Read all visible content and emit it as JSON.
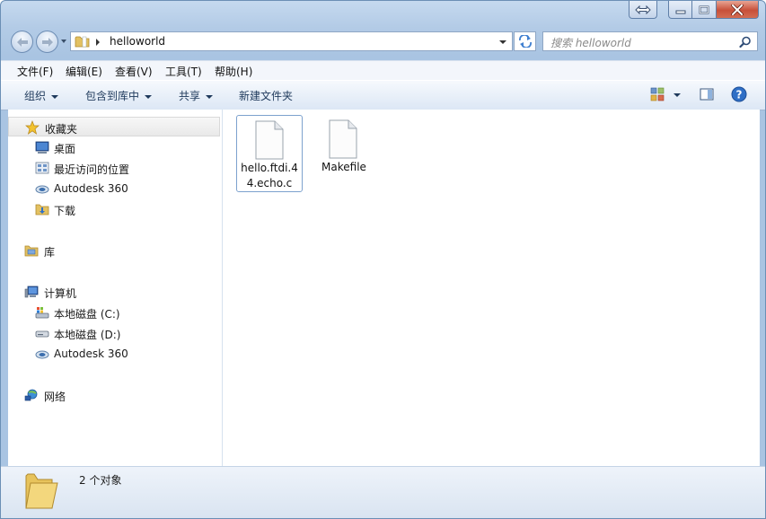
{
  "window": {
    "address": {
      "path": "helloworld"
    },
    "search": {
      "placeholder": "搜索 helloworld"
    }
  },
  "menu": [
    "文件(F)",
    "编辑(E)",
    "查看(V)",
    "工具(T)",
    "帮助(H)"
  ],
  "commands": {
    "organize": "组织",
    "include_in_library": "包含到库中",
    "share": "共享",
    "new_folder": "新建文件夹"
  },
  "nav": {
    "favorites": "收藏夹",
    "desktop": "桌面",
    "recent": "最近访问的位置",
    "autodesk_fav": "Autodesk 360",
    "downloads": "下载",
    "libraries": "库",
    "computer": "计算机",
    "drive_c": "本地磁盘 (C:)",
    "drive_d": "本地磁盘 (D:)",
    "autodesk_comp": "Autodesk 360",
    "network": "网络"
  },
  "files": [
    {
      "name": "hello.ftdi.44.echo.c",
      "selected": true
    },
    {
      "name": "Makefile",
      "selected": false
    }
  ],
  "status": {
    "count": "2 个对象"
  }
}
